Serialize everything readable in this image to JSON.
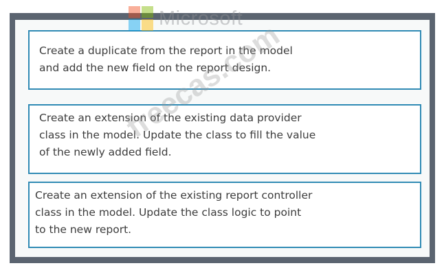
{
  "watermark": {
    "brand": "Microsoft",
    "logo_colors": [
      "#f25022",
      "#7fba00",
      "#00a4ef",
      "#ffb900"
    ],
    "site": "freecas.com"
  },
  "options": [
    {
      "text": "Create a duplicate from the report in the model\nand add the new field on the report design."
    },
    {
      "text": "Create an extension of the existing data provider\nclass in the model. Update the class to fill the value\nof the newly added field."
    },
    {
      "text": "Create an extension of the existing report controller\nclass in the model. Update the class logic to point\nto the new report."
    }
  ]
}
